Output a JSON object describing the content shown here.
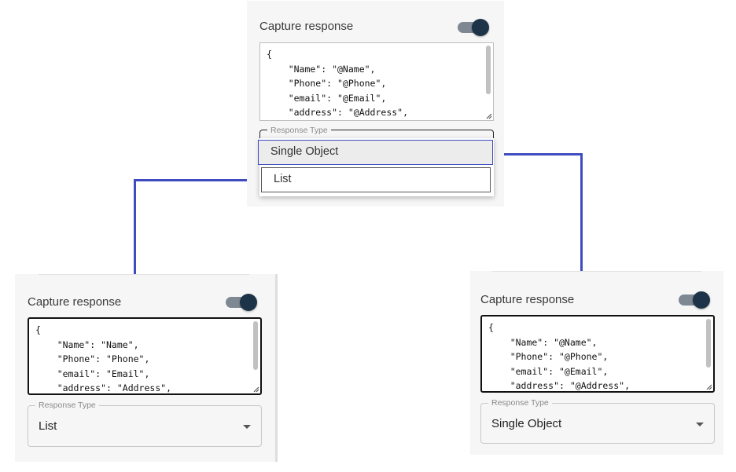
{
  "colors": {
    "accent": "#3f4cc0",
    "toggle_knob": "#1d3347",
    "toggle_track": "#7e8892",
    "panel_bg": "#f6f6f6"
  },
  "top_panel": {
    "title": "Capture response",
    "toggle_on": true,
    "code_lines": [
      "{",
      "    \"Name\": \"@Name\",",
      "    \"Phone\": \"@Phone\",",
      "    \"email\": \"@Email\",",
      "    \"address\": \"@Address\","
    ],
    "field_label": "Response Type",
    "dropdown_options": [
      "Single Object",
      "List"
    ],
    "highlighted_option": "Single Object"
  },
  "left_panel": {
    "title": "Capture response",
    "toggle_on": true,
    "code_lines": [
      "{",
      "    \"Name\": \"Name\",",
      "    \"Phone\": \"Phone\",",
      "    \"email\": \"Email\",",
      "    \"address\": \"Address\","
    ],
    "field_label": "Response Type",
    "field_value": "List"
  },
  "right_panel": {
    "title": "Capture response",
    "toggle_on": true,
    "code_lines": [
      "{",
      "    \"Name\": \"@Name\",",
      "    \"Phone\": \"@Phone\",",
      "    \"email\": \"@Email\",",
      "    \"address\": \"@Address\","
    ],
    "field_label": "Response Type",
    "field_value": "Single Object"
  },
  "icons": {
    "dropdown_caret": "triangle-down-icon",
    "resize_grip": "resize-grip-icon"
  }
}
